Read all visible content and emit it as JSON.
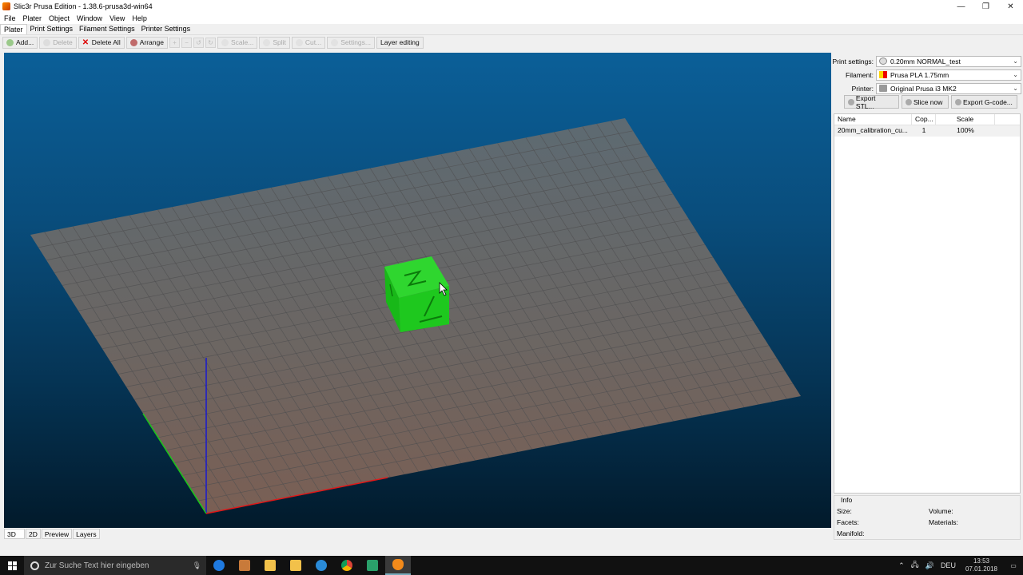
{
  "window": {
    "title": "Slic3r Prusa Edition - 1.38.6-prusa3d-win64",
    "controls": {
      "minimize": "—",
      "maximize": "❐",
      "close": "✕"
    }
  },
  "menu": [
    "File",
    "Plater",
    "Object",
    "Window",
    "View",
    "Help"
  ],
  "tabs": [
    "Plater",
    "Print Settings",
    "Filament Settings",
    "Printer Settings"
  ],
  "toolbar": {
    "add": "Add...",
    "delete": "Delete",
    "delete_all": "Delete All",
    "arrange": "Arrange",
    "scale": "Scale...",
    "split": "Split",
    "cut": "Cut...",
    "settings": "Settings...",
    "layer_editing": "Layer editing"
  },
  "view_tabs": [
    "3D",
    "2D",
    "Preview",
    "Layers"
  ],
  "right_panel": {
    "print_settings_label": "Print settings:",
    "print_settings_value": "0.20mm NORMAL_test",
    "filament_label": "Filament:",
    "filament_value": "Prusa PLA 1.75mm",
    "printer_label": "Printer:",
    "printer_value": "Original Prusa i3 MK2",
    "chevron": "⌄",
    "export_stl": "Export STL...",
    "slice_now": "Slice now",
    "export_gcode": "Export G-code..."
  },
  "object_table": {
    "headers": [
      "Name",
      "Cop...",
      "Scale"
    ],
    "rows": [
      [
        "20mm_calibration_cu...",
        "1",
        "100%"
      ]
    ]
  },
  "info": {
    "title": "Info",
    "size_label": "Size:",
    "volume_label": "Volume:",
    "facets_label": "Facets:",
    "materials_label": "Materials:",
    "manifold_label": "Manifold:"
  },
  "taskbar": {
    "search_placeholder": "Zur Suche Text hier eingeben",
    "language": "DEU",
    "time": "13:53",
    "date": "07.01.2018",
    "mic": "🎙",
    "tray": [
      "⌃",
      "🖧",
      "🔊"
    ],
    "notification": "▭",
    "apps": [
      {
        "name": "edge",
        "color": "#1f7ae0"
      },
      {
        "name": "tools",
        "color": "#c87a3a"
      },
      {
        "name": "explorer",
        "color": "#f2c14a"
      },
      {
        "name": "store",
        "color": "#f2c14a"
      },
      {
        "name": "ccleaner",
        "color": "#2a8bd8"
      },
      {
        "name": "chrome",
        "color": "#e2a73a"
      },
      {
        "name": "app-green",
        "color": "#2aa06a"
      },
      {
        "name": "slic3r",
        "color": "#f28a1a"
      }
    ]
  },
  "colors": {
    "model": "#1ec81e",
    "bed": "#6e6b6a",
    "axis_x": "#e01818",
    "axis_y": "#18c818",
    "axis_z": "#1818d0"
  }
}
